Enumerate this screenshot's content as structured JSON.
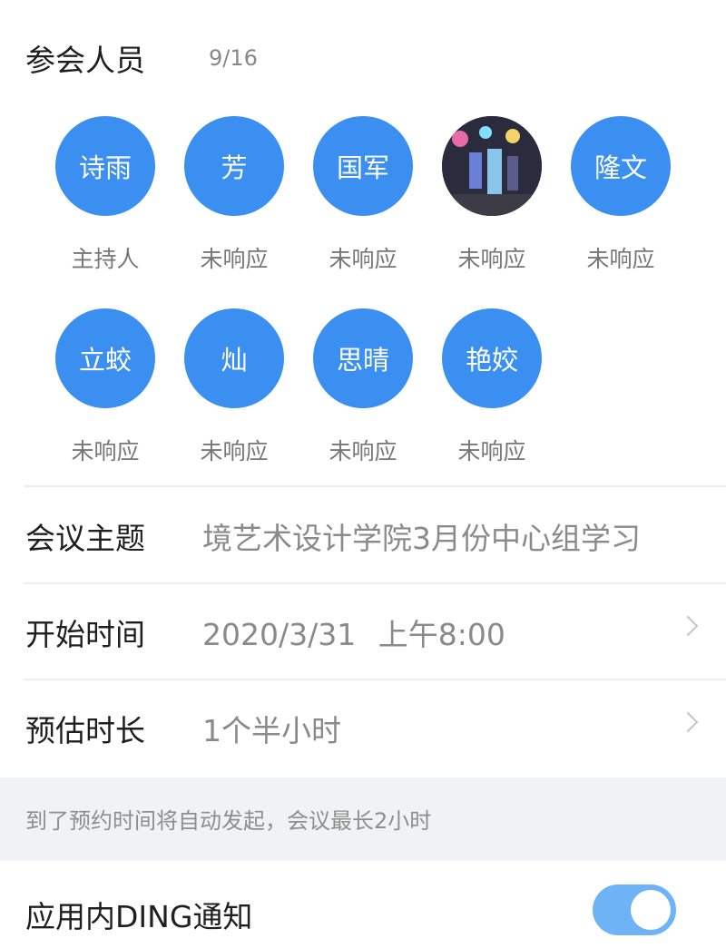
{
  "participants": {
    "title": "参会人员",
    "count": "9/16",
    "members": [
      {
        "name": "诗雨",
        "status": "主持人"
      },
      {
        "name": "芳",
        "status": "未响应"
      },
      {
        "name": "国军",
        "status": "未响应"
      },
      {
        "name": "",
        "status": "未响应",
        "photo": true
      },
      {
        "name": "隆文",
        "status": "未响应"
      },
      {
        "name": "立蛟",
        "status": "未响应"
      },
      {
        "name": "灿",
        "status": "未响应"
      },
      {
        "name": "思晴",
        "status": "未响应"
      },
      {
        "name": "艳姣",
        "status": "未响应"
      }
    ]
  },
  "form": {
    "topic_label": "会议主题",
    "topic_value": "境艺术设计学院3月份中心组学习",
    "start_label": "开始时间",
    "start_date": "2020/3/31",
    "start_time": "上午8:00",
    "duration_label": "预估时长",
    "duration_value": "1个半小时"
  },
  "note": "到了预约时间将自动发起，会议最长2小时",
  "ding": {
    "label": "应用内DING通知",
    "enabled": true
  },
  "colors": {
    "accent": "#3a8ff0",
    "toggle": "#6fb3f7"
  }
}
